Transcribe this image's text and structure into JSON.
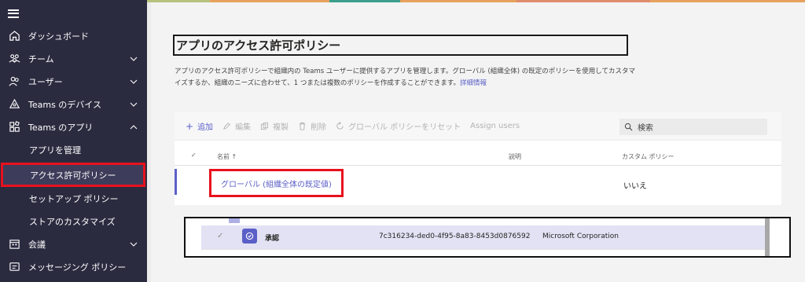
{
  "sidebar": {
    "menu_icon": "hamburger-icon",
    "items": [
      {
        "label": "ダッシュボード",
        "icon": "home-icon"
      },
      {
        "label": "チーム",
        "icon": "team-icon"
      },
      {
        "label": "ユーザー",
        "icon": "users-icon"
      },
      {
        "label": "Teams のデバイス",
        "icon": "device-icon"
      },
      {
        "label": "Teams のアプリ",
        "icon": "apps-icon"
      },
      {
        "label": "アプリを管理"
      },
      {
        "label": "アクセス許可ポリシー"
      },
      {
        "label": "セットアップ ポリシー"
      },
      {
        "label": "ストアのカスタマイズ"
      },
      {
        "label": "会議",
        "icon": "calendar-icon"
      },
      {
        "label": "メッセージング ポリシー",
        "icon": "message-icon"
      }
    ]
  },
  "page": {
    "title": "アプリのアクセス許可ポリシー",
    "description": "アプリのアクセス許可ポリシーで組織内の Teams ユーザーに提供するアプリを管理します。グローバル (組織全体) の既定のポリシーを使用してカスタマイズするか、組織のニーズに合わせて、1 つまたは複数のポリシーを作成することができます。",
    "learn_more": "詳細情報"
  },
  "toolbar": {
    "add": "追加",
    "edit": "編集",
    "duplicate": "複製",
    "delete": "削除",
    "reset": "グローバル ポリシーをリセット",
    "assign": "Assign users",
    "search_placeholder": "検索"
  },
  "table": {
    "headers": {
      "check": "✓",
      "name": "名前 ↑",
      "description": "説明",
      "custom": "カスタム ポリシー"
    },
    "rows": [
      {
        "name": "グローバル (組織全体の既定値)",
        "description": "",
        "custom": "いいえ"
      }
    ]
  },
  "app_row": {
    "check": "✓",
    "name": "承認",
    "id": "7c316234-ded0-4f95-8a83-8453d0876592",
    "publisher": "Microsoft Corporation"
  },
  "colors": {
    "sidebar_bg": "#2b2b40",
    "accent": "#5b5fc7",
    "highlight_border": "#e8111d"
  }
}
